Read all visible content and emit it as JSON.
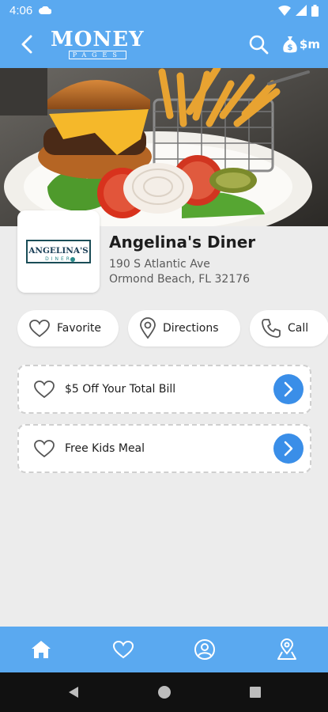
{
  "status_bar": {
    "time": "4:06"
  },
  "header": {
    "logo_main": "MONEY",
    "logo_sub": "PAGES",
    "money_label": "$m"
  },
  "business": {
    "name": "Angelina's Diner",
    "address_line1": "190 S Atlantic Ave",
    "address_line2": "Ormond Beach, FL 32176",
    "logo_text_main": "ANGELINA'S",
    "logo_text_sub": "DINER"
  },
  "actions": {
    "favorite": "Favorite",
    "directions": "Directions",
    "call": "Call"
  },
  "deals": [
    {
      "title": "$5 Off Your Total Bill"
    },
    {
      "title": "Free Kids Meal"
    }
  ],
  "colors": {
    "brand_blue": "#5aa9f0",
    "arrow_blue": "#3a8ee8"
  }
}
